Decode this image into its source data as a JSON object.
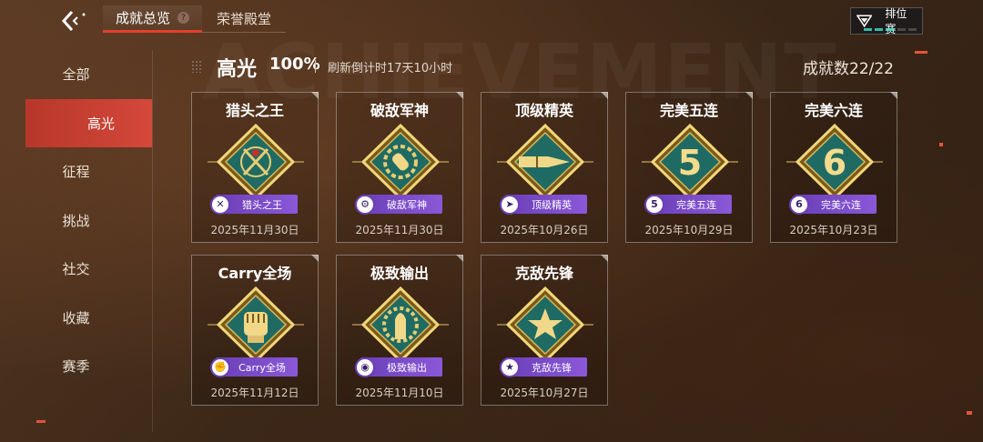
{
  "watermark": "ACHIEVEMENT",
  "tabs": [
    {
      "label": "成就总览",
      "help": "?"
    },
    {
      "label": "荣誉殿堂"
    }
  ],
  "rank_button": {
    "label": "排位赛"
  },
  "sidebar": {
    "items": [
      {
        "label": "全部"
      },
      {
        "label": "高光"
      },
      {
        "label": "征程"
      },
      {
        "label": "挑战"
      },
      {
        "label": "社交"
      },
      {
        "label": "收藏"
      },
      {
        "label": "赛季"
      }
    ],
    "active_index": 1
  },
  "header": {
    "title": "高光",
    "percent": "100%",
    "refresh": "刷新倒计时17天10小时",
    "count": "成就数22/22"
  },
  "cards": [
    {
      "title": "猎头之王",
      "badge": "猎头之王",
      "date": "2025年11月30日",
      "icon": "crosshair-axes-icon"
    },
    {
      "title": "破敌军神",
      "badge": "破敌军神",
      "date": "2025年11月30日",
      "icon": "bullet-target-icon"
    },
    {
      "title": "顶级精英",
      "badge": "顶级精英",
      "date": "2025年10月26日",
      "icon": "bullet-icon"
    },
    {
      "title": "完美五连",
      "badge": "完美五连",
      "date": "2025年10月29日",
      "icon": "number-five-icon",
      "numeral": "5"
    },
    {
      "title": "完美六连",
      "badge": "完美六连",
      "date": "2025年10月23日",
      "icon": "number-six-icon",
      "numeral": "6"
    },
    {
      "title": "Carry全场",
      "badge": "Carry全场",
      "date": "2025年11月12日",
      "icon": "fist-icon"
    },
    {
      "title": "极致输出",
      "badge": "极致输出",
      "date": "2025年11月10日",
      "icon": "shell-gear-icon"
    },
    {
      "title": "克敌先锋",
      "badge": "克敌先锋",
      "date": "2025年10月27日",
      "icon": "star-icon"
    }
  ],
  "colors": {
    "accent": "#d4483a",
    "badge_purple": "#7a4bc8",
    "emblem_teal": "#1f6b63",
    "emblem_gold": "#e2c36a"
  }
}
